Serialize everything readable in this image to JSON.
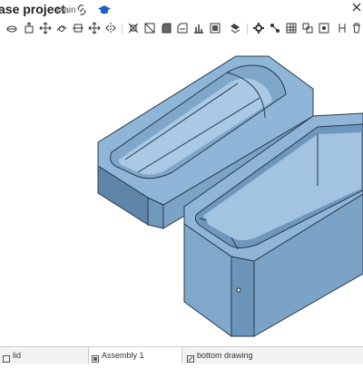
{
  "header": {
    "title": "ase project",
    "branch": "Main"
  },
  "icons": {
    "link": "link-icon",
    "education": "graduation-cap-icon",
    "close": "close-icon"
  },
  "toolbar": {
    "tools": [
      "sketch-icon",
      "extrude-icon",
      "revolve-icon",
      "sweep-icon",
      "loft-icon",
      "move-icon",
      "mirror-icon",
      "pattern-icon",
      "boolean-icon",
      "fillet-icon",
      "chamfer-icon",
      "shell-icon",
      "hole-icon",
      "mate-icon",
      "gear-icon",
      "table-icon",
      "delete-icon"
    ]
  },
  "tabs": [
    {
      "label": "lid",
      "active": false
    },
    {
      "label": "Assembly 1",
      "active": true
    },
    {
      "label": "bottom drawing",
      "active": false
    }
  ],
  "colors": {
    "part_fill": "#8fb6d8",
    "part_dark": "#6f99be",
    "part_light": "#b9d4ea",
    "edge": "#2a3a4a"
  }
}
